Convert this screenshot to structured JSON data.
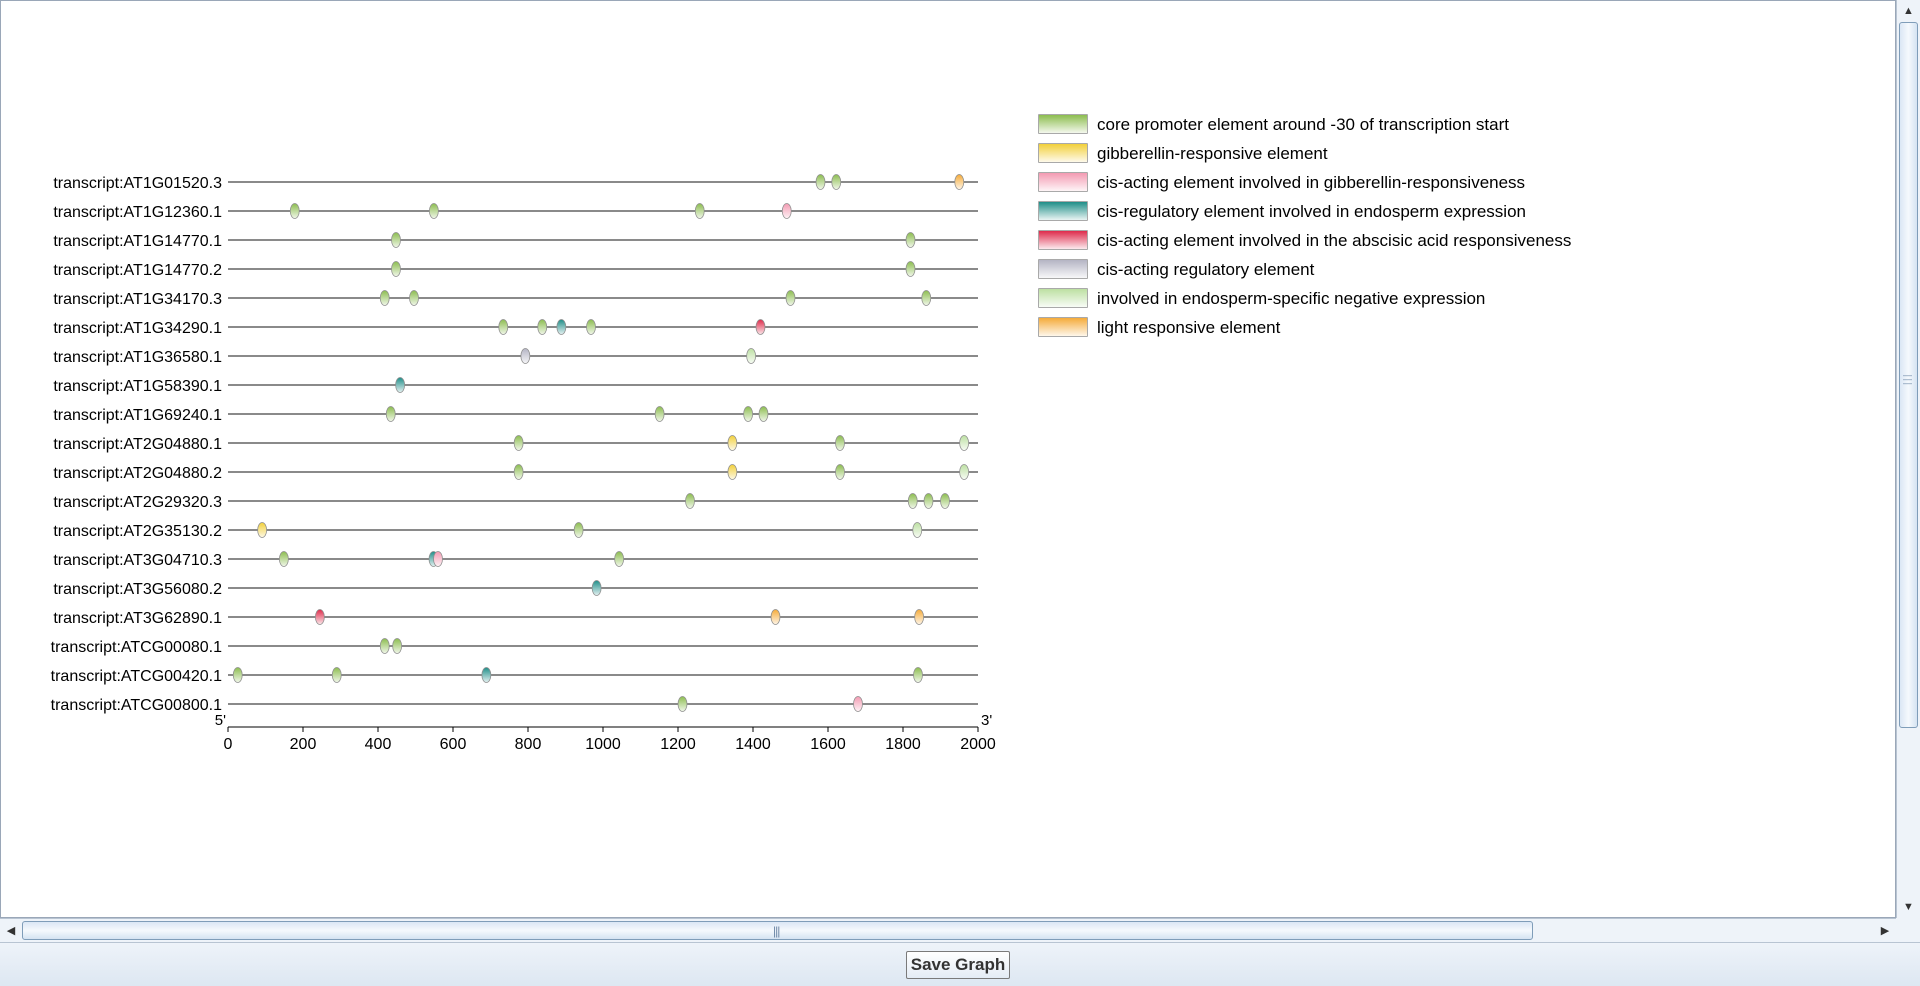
{
  "toolbar": {
    "save_label": "Save Graph"
  },
  "chart_data": {
    "type": "scatter",
    "xlim": [
      0,
      2000
    ],
    "x_ticks": [
      0,
      200,
      400,
      600,
      800,
      1000,
      1200,
      1400,
      1600,
      1800,
      2000
    ],
    "five_prime_label": "5'",
    "three_prime_label": "3'",
    "legend": [
      {
        "name": "core promoter element around -30 of transcription start",
        "color": "#8cbd4f"
      },
      {
        "name": "gibberellin-responsive element",
        "color": "#f2d03a"
      },
      {
        "name": "cis-acting element involved in gibberellin-responsiveness",
        "color": "#f39ab2"
      },
      {
        "name": "cis-regulatory element involved in endosperm expression",
        "color": "#1f8e88"
      },
      {
        "name": "cis-acting element involved in the abscisic acid responsiveness",
        "color": "#de2b4b"
      },
      {
        "name": "cis-acting regulatory element",
        "color": "#b4b4c4"
      },
      {
        "name": "involved in endosperm-specific negative expression",
        "color": "#bde0a2"
      },
      {
        "name": "light responsive element",
        "color": "#f5ab3a"
      }
    ],
    "transcripts": [
      {
        "name": "transcript:AT1G01520.3",
        "elements": [
          [
            1580,
            0
          ],
          [
            1622,
            0
          ],
          [
            1950,
            7
          ]
        ]
      },
      {
        "name": "transcript:AT1G12360.1",
        "elements": [
          [
            178,
            0
          ],
          [
            549,
            0
          ],
          [
            1258,
            0
          ],
          [
            1490,
            2
          ]
        ]
      },
      {
        "name": "transcript:AT1G14770.1",
        "elements": [
          [
            448,
            0
          ],
          [
            1820,
            0
          ]
        ]
      },
      {
        "name": "transcript:AT1G14770.2",
        "elements": [
          [
            448,
            0
          ],
          [
            1820,
            0
          ]
        ]
      },
      {
        "name": "transcript:AT1G34170.3",
        "elements": [
          [
            418,
            0
          ],
          [
            496,
            0
          ],
          [
            1500,
            0
          ],
          [
            1862,
            0
          ]
        ]
      },
      {
        "name": "transcript:AT1G34290.1",
        "elements": [
          [
            734,
            0
          ],
          [
            838,
            0
          ],
          [
            889,
            3
          ],
          [
            968,
            0
          ],
          [
            1420,
            4
          ]
        ]
      },
      {
        "name": "transcript:AT1G36580.1",
        "elements": [
          [
            793,
            5
          ],
          [
            1395,
            6
          ]
        ]
      },
      {
        "name": "transcript:AT1G58390.1",
        "elements": [
          [
            459,
            3
          ]
        ]
      },
      {
        "name": "transcript:AT1G69240.1",
        "elements": [
          [
            434,
            0
          ],
          [
            1151,
            0
          ],
          [
            1387,
            0
          ],
          [
            1428,
            0
          ]
        ]
      },
      {
        "name": "transcript:AT2G04880.1",
        "elements": [
          [
            775,
            0
          ],
          [
            1345,
            1
          ],
          [
            1632,
            0
          ],
          [
            1963,
            6
          ]
        ]
      },
      {
        "name": "transcript:AT2G04880.2",
        "elements": [
          [
            775,
            0
          ],
          [
            1345,
            1
          ],
          [
            1632,
            0
          ],
          [
            1963,
            6
          ]
        ]
      },
      {
        "name": "transcript:AT2G29320.3",
        "elements": [
          [
            1232,
            0
          ],
          [
            1826,
            0
          ],
          [
            1868,
            0
          ],
          [
            1912,
            0
          ]
        ]
      },
      {
        "name": "transcript:AT2G35130.2",
        "elements": [
          [
            91,
            1
          ],
          [
            935,
            0
          ],
          [
            1838,
            6
          ]
        ]
      },
      {
        "name": "transcript:AT3G04710.3",
        "elements": [
          [
            149,
            0
          ],
          [
            548,
            3
          ],
          [
            560,
            2
          ],
          [
            1043,
            0
          ]
        ]
      },
      {
        "name": "transcript:AT3G56080.2",
        "elements": [
          [
            983,
            3
          ]
        ]
      },
      {
        "name": "transcript:AT3G62890.1",
        "elements": [
          [
            245,
            4
          ],
          [
            1460,
            7
          ],
          [
            1843,
            7
          ]
        ]
      },
      {
        "name": "transcript:ATCG00080.1",
        "elements": [
          [
            418,
            0
          ],
          [
            451,
            0
          ]
        ]
      },
      {
        "name": "transcript:ATCG00420.1",
        "elements": [
          [
            26,
            0
          ],
          [
            290,
            0
          ],
          [
            689,
            3
          ],
          [
            1840,
            0
          ]
        ]
      },
      {
        "name": "transcript:ATCG00800.1",
        "elements": [
          [
            1212,
            0
          ],
          [
            1680,
            2
          ]
        ]
      }
    ]
  }
}
